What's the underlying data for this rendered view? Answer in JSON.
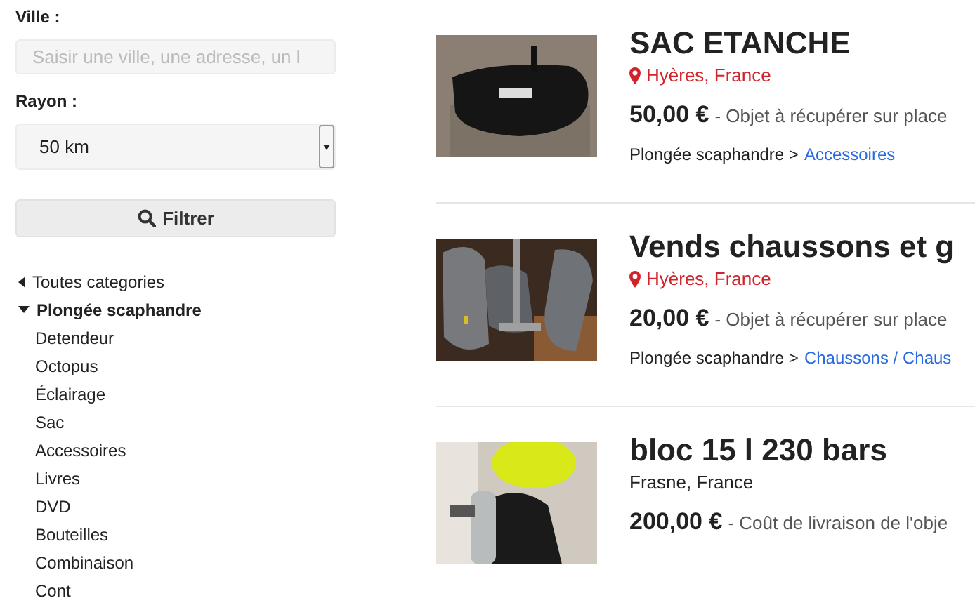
{
  "filters": {
    "city_label": "Ville :",
    "city_field": {
      "placeholder": "Saisir une ville, une adresse, un l"
    },
    "radius_label": "Rayon :",
    "radius_select": {
      "value": "50 km"
    },
    "filter_button": "Filtrer"
  },
  "categories": {
    "back_link": "Toutes categories",
    "current": {
      "label": "Plongée scaphandre",
      "expanded": true
    },
    "children": [
      {
        "label": "Detendeur"
      },
      {
        "label": "Octopus"
      },
      {
        "label": "Éclairage"
      },
      {
        "label": "Sac"
      },
      {
        "label": "Accessoires"
      },
      {
        "label": "Livres"
      },
      {
        "label": "DVD"
      },
      {
        "label": "Bouteilles"
      },
      {
        "label": "Combinaison"
      },
      {
        "label": "Cont"
      }
    ]
  },
  "listings": [
    {
      "title": "SAC ETANCHE",
      "location": "Hyères, France",
      "pin": true,
      "price": "50,00 €",
      "delivery": "- Objet à récupérer sur place",
      "category": "Plongée scaphandre >",
      "subcategory": "Accessoires"
    },
    {
      "title": "Vends chaussons et g",
      "location": "Hyères, France",
      "pin": true,
      "price": "20,00 €",
      "delivery": "- Objet à récupérer sur place",
      "category": "Plongée scaphandre >",
      "subcategory": "Chaussons / Chaus"
    },
    {
      "title": "bloc 15 l 230 bars",
      "location": "Frasne, France",
      "pin": false,
      "price": "200,00 €",
      "delivery": "- Coût de livraison de l'obje"
    }
  ]
}
